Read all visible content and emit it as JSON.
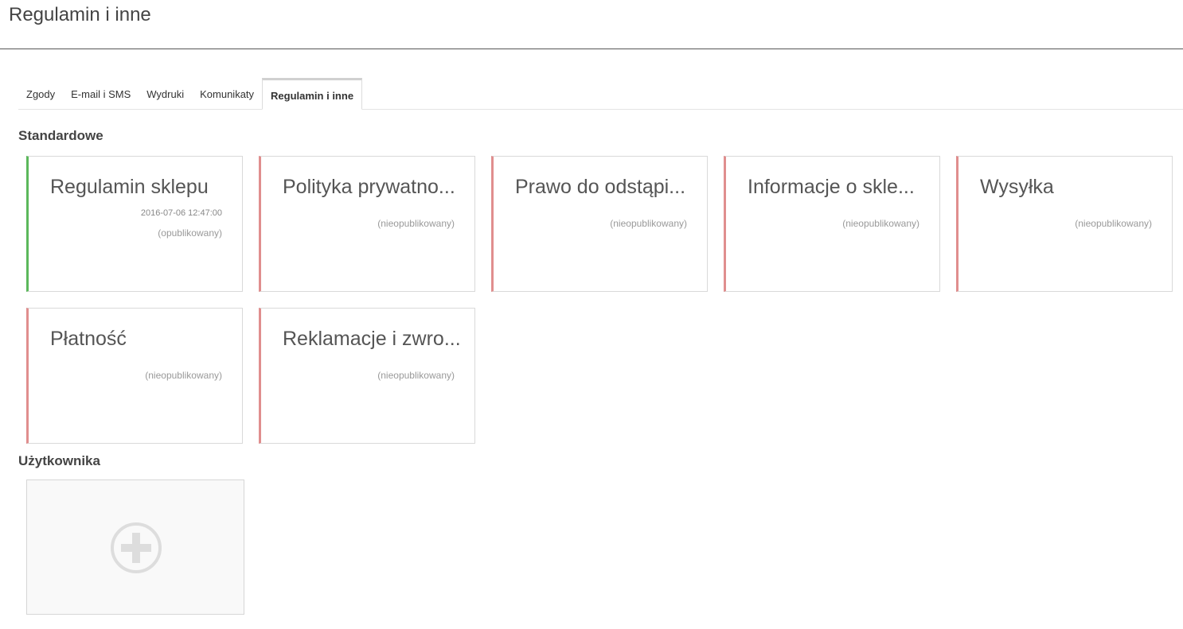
{
  "page": {
    "title": "Regulamin i inne"
  },
  "tabs": [
    {
      "label": "Zgody"
    },
    {
      "label": "E-mail i SMS"
    },
    {
      "label": "Wydruki"
    },
    {
      "label": "Komunikaty"
    },
    {
      "label": "Regulamin i inne",
      "active": true
    }
  ],
  "sections": {
    "standard": {
      "title": "Standardowe",
      "cards": [
        {
          "title": "Regulamin sklepu",
          "date": "2016-07-06 12:47:00",
          "status": "(opublikowany)",
          "published": true
        },
        {
          "title": "Polityka prywatno...",
          "status": "(nieopublikowany)",
          "published": false
        },
        {
          "title": "Prawo do odstąpi...",
          "status": "(nieopublikowany)",
          "published": false
        },
        {
          "title": "Informacje o skle...",
          "status": "(nieopublikowany)",
          "published": false
        },
        {
          "title": "Wysyłka",
          "status": "(nieopublikowany)",
          "published": false
        },
        {
          "title": "Płatność",
          "status": "(nieopublikowany)",
          "published": false
        },
        {
          "title": "Reklamacje i zwro...",
          "status": "(nieopublikowany)",
          "published": false
        }
      ]
    },
    "user": {
      "title": "Użytkownika",
      "add_icon": "plus-circle-icon"
    }
  },
  "colors": {
    "published": "#5cb85c",
    "unpublished": "#e08e8e"
  }
}
